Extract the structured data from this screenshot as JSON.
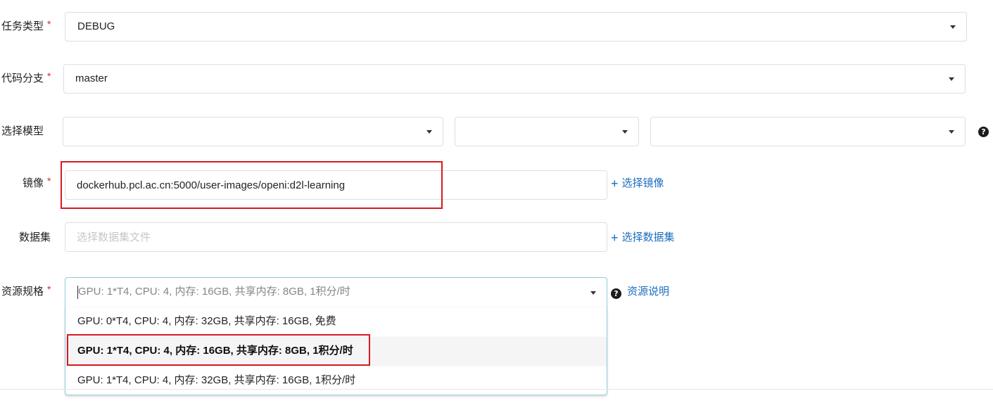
{
  "form": {
    "task_type": {
      "label": "任务类型",
      "required_mark": "*",
      "value": "DEBUG"
    },
    "code_branch": {
      "label": "代码分支",
      "required_mark": "*",
      "value": "master"
    },
    "model": {
      "label": "选择模型",
      "select1_value": "",
      "select2_value": "",
      "select3_value": "",
      "help_icon": "question-circle-icon"
    },
    "image": {
      "label": "镜像",
      "required_mark": "*",
      "value": "dockerhub.pcl.ac.cn:5000/user-images/openi:d2l-learning",
      "select_link": "选择镜像",
      "select_link_icon": "plus-icon"
    },
    "dataset": {
      "label": "数据集",
      "placeholder": "选择数据集文件",
      "select_link": "选择数据集",
      "select_link_icon": "plus-icon"
    },
    "resource_spec": {
      "label": "资源规格",
      "required_mark": "*",
      "current_text": "GPU: 1*T4, CPU: 4, 内存: 16GB, 共享内存: 8GB, 1积分/时",
      "help_link": "资源说明",
      "help_icon": "question-circle-icon",
      "options": [
        "GPU: 0*T4, CPU: 4, 内存: 32GB, 共享内存: 16GB, 免费",
        "GPU: 1*T4, CPU: 4, 内存: 16GB, 共享内存: 8GB, 1积分/时",
        "GPU: 1*T4, CPU: 4, 内存: 32GB, 共享内存: 16GB, 1积分/时"
      ],
      "selected_index": 1
    }
  },
  "colors": {
    "required": "#db2828",
    "link": "#1a6ebe",
    "highlight_box": "#d71920",
    "menu_border": "#96c8da"
  }
}
